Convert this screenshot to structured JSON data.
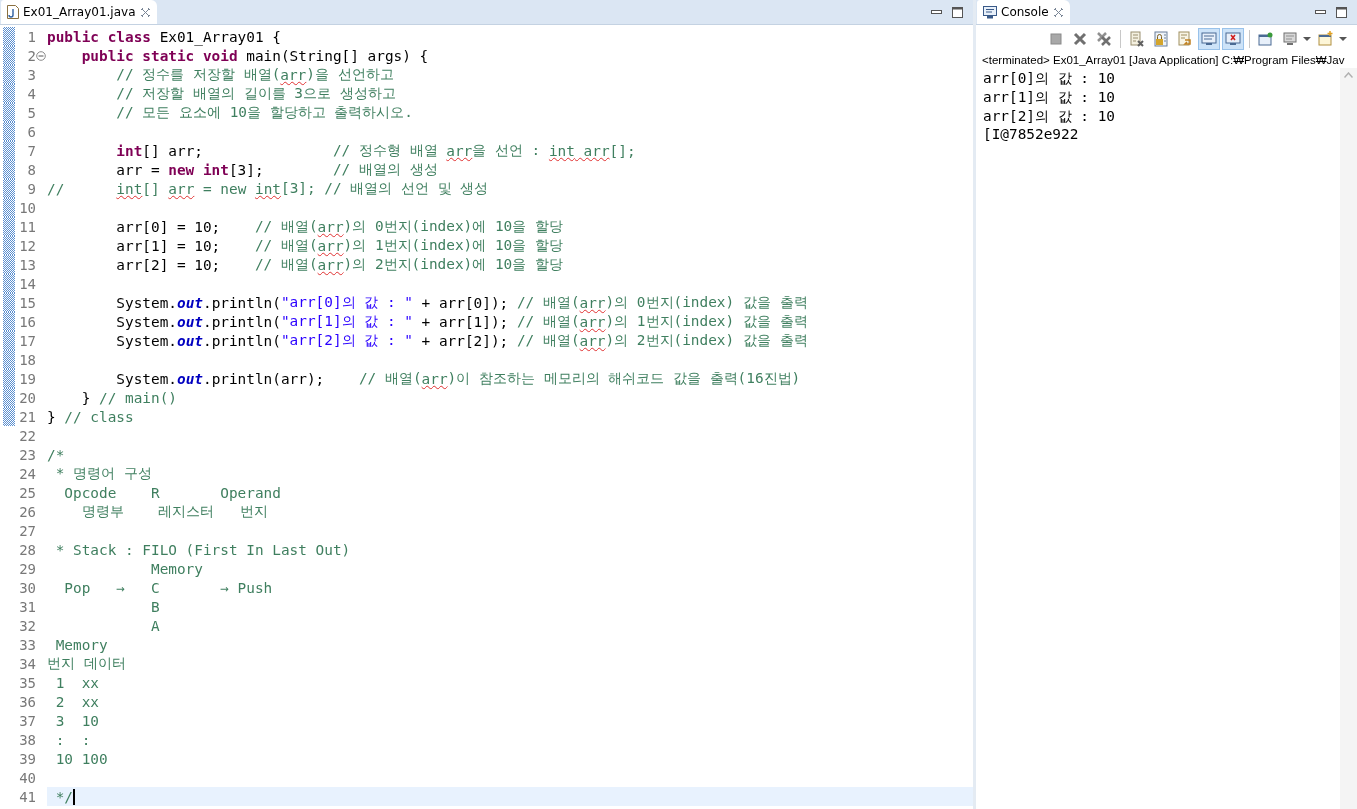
{
  "editor": {
    "tabs": [
      {
        "label": "Ex01_Array01.java",
        "selected": true
      }
    ],
    "lines": [
      {
        "number": "1",
        "changed": true,
        "fold": false,
        "current": false,
        "segments": [
          {
            "kind": "kw",
            "text": "public"
          },
          {
            "kind": "kw",
            "text": " class"
          },
          {
            "kind": "tx",
            "text": " Ex01_Array01 {"
          }
        ]
      },
      {
        "number": "2",
        "changed": true,
        "fold": true,
        "current": false,
        "segments": [
          {
            "kind": "kw",
            "text": "    public"
          },
          {
            "kind": "kw",
            "text": " static"
          },
          {
            "kind": "kw",
            "text": " void"
          },
          {
            "kind": "tx",
            "text": " main(String[] args) {"
          }
        ]
      },
      {
        "number": "3",
        "changed": true,
        "fold": false,
        "current": false,
        "segments": [
          {
            "kind": "cm",
            "text": "        // 정수를 저장할 배열("
          },
          {
            "kind": "spell",
            "text": "arr"
          },
          {
            "kind": "cm",
            "text": ")을 선언하고"
          }
        ]
      },
      {
        "number": "4",
        "changed": true,
        "fold": false,
        "current": false,
        "segments": [
          {
            "kind": "cm",
            "text": "        // 저장할 배열의 길이를 3으로 생성하고"
          }
        ]
      },
      {
        "number": "5",
        "changed": true,
        "fold": false,
        "current": false,
        "segments": [
          {
            "kind": "cm",
            "text": "        // 모든 요소에 10을 할당하고 출력하시오."
          }
        ]
      },
      {
        "number": "6",
        "changed": true,
        "fold": false,
        "current": false
      },
      {
        "number": "7",
        "changed": true,
        "fold": false,
        "current": false,
        "segments": [
          {
            "kind": "kw",
            "text": "        int"
          },
          {
            "kind": "tx",
            "text": "[] arr;"
          },
          {
            "kind": "cm",
            "text": "               // 정수형 배열 "
          },
          {
            "kind": "spell",
            "text": "arr"
          },
          {
            "kind": "cm",
            "text": "을 선언 : "
          },
          {
            "kind": "spell",
            "text": "int"
          },
          {
            "kind": "spell",
            "text": " arr"
          },
          {
            "kind": "cm",
            "text": "[];"
          }
        ]
      },
      {
        "number": "8",
        "changed": true,
        "fold": false,
        "current": false,
        "segments": [
          {
            "kind": "tx",
            "text": "        arr = "
          },
          {
            "kind": "kw",
            "text": "new"
          },
          {
            "kind": "kw",
            "text": " int"
          },
          {
            "kind": "tx",
            "text": "[3];"
          },
          {
            "kind": "cm",
            "text": "        // 배열의 생성"
          }
        ]
      },
      {
        "number": "9",
        "changed": true,
        "fold": false,
        "current": false,
        "segments": [
          {
            "kind": "cm",
            "text": "//      "
          },
          {
            "kind": "spell",
            "text": "int"
          },
          {
            "kind": "cm",
            "text": "[] "
          },
          {
            "kind": "spell",
            "text": "arr"
          },
          {
            "kind": "cm",
            "text": " = new "
          },
          {
            "kind": "spell",
            "text": "int"
          },
          {
            "kind": "cm",
            "text": "[3]; // 배열의 선언 및 생성"
          }
        ]
      },
      {
        "number": "10",
        "changed": true,
        "fold": false,
        "current": false
      },
      {
        "number": "11",
        "changed": true,
        "fold": false,
        "current": false,
        "segments": [
          {
            "kind": "tx",
            "text": "        arr[0] = 10;    "
          },
          {
            "kind": "cm",
            "text": "// 배열("
          },
          {
            "kind": "spell",
            "text": "arr"
          },
          {
            "kind": "cm",
            "text": ")의 0번지(index)에 10을 할당"
          }
        ]
      },
      {
        "number": "12",
        "changed": true,
        "fold": false,
        "current": false,
        "segments": [
          {
            "kind": "tx",
            "text": "        arr[1] = 10;    "
          },
          {
            "kind": "cm",
            "text": "// 배열("
          },
          {
            "kind": "spell",
            "text": "arr"
          },
          {
            "kind": "cm",
            "text": ")의 1번지(index)에 10을 할당"
          }
        ]
      },
      {
        "number": "13",
        "changed": true,
        "fold": false,
        "current": false,
        "segments": [
          {
            "kind": "tx",
            "text": "        arr[2] = 10;    "
          },
          {
            "kind": "cm",
            "text": "// 배열("
          },
          {
            "kind": "spell",
            "text": "arr"
          },
          {
            "kind": "cm",
            "text": ")의 2번지(index)에 10을 할당"
          }
        ]
      },
      {
        "number": "14",
        "changed": true,
        "fold": false,
        "current": false
      },
      {
        "number": "15",
        "changed": true,
        "fold": false,
        "current": false,
        "segments": [
          {
            "kind": "tx",
            "text": "        System."
          },
          {
            "kind": "field",
            "text": "out"
          },
          {
            "kind": "tx",
            "text": ".println("
          },
          {
            "kind": "str",
            "text": "\"arr[0]의 값 : \""
          },
          {
            "kind": "tx",
            "text": " + arr[0]); "
          },
          {
            "kind": "cm",
            "text": "// 배열("
          },
          {
            "kind": "spell",
            "text": "arr"
          },
          {
            "kind": "cm",
            "text": ")의 0번지(index) 값을 출력"
          }
        ]
      },
      {
        "number": "16",
        "changed": true,
        "fold": false,
        "current": false,
        "segments": [
          {
            "kind": "tx",
            "text": "        System."
          },
          {
            "kind": "field",
            "text": "out"
          },
          {
            "kind": "tx",
            "text": ".println("
          },
          {
            "kind": "str",
            "text": "\"arr[1]의 값 : \""
          },
          {
            "kind": "tx",
            "text": " + arr[1]); "
          },
          {
            "kind": "cm",
            "text": "// 배열("
          },
          {
            "kind": "spell",
            "text": "arr"
          },
          {
            "kind": "cm",
            "text": ")의 1번지(index) 값을 출력"
          }
        ]
      },
      {
        "number": "17",
        "changed": true,
        "fold": false,
        "current": false,
        "segments": [
          {
            "kind": "tx",
            "text": "        System."
          },
          {
            "kind": "field",
            "text": "out"
          },
          {
            "kind": "tx",
            "text": ".println("
          },
          {
            "kind": "str",
            "text": "\"arr[2]의 값 : \""
          },
          {
            "kind": "tx",
            "text": " + arr[2]); "
          },
          {
            "kind": "cm",
            "text": "// 배열("
          },
          {
            "kind": "spell",
            "text": "arr"
          },
          {
            "kind": "cm",
            "text": ")의 2번지(index) 값을 출력"
          }
        ]
      },
      {
        "number": "18",
        "changed": true,
        "fold": false,
        "current": false
      },
      {
        "number": "19",
        "changed": true,
        "fold": false,
        "current": false,
        "segments": [
          {
            "kind": "tx",
            "text": "        System."
          },
          {
            "kind": "field",
            "text": "out"
          },
          {
            "kind": "tx",
            "text": ".println(arr);    "
          },
          {
            "kind": "cm",
            "text": "// 배열("
          },
          {
            "kind": "spell",
            "text": "arr"
          },
          {
            "kind": "cm",
            "text": ")이 참조하는 메모리의 해쉬코드 값을 출력(16진법)"
          }
        ]
      },
      {
        "number": "20",
        "changed": true,
        "fold": false,
        "current": false,
        "segments": [
          {
            "kind": "tx",
            "text": "    } "
          },
          {
            "kind": "cm",
            "text": "// main()"
          }
        ]
      },
      {
        "number": "21",
        "changed": true,
        "fold": false,
        "current": false,
        "segments": [
          {
            "kind": "tx",
            "text": "} "
          },
          {
            "kind": "cm",
            "text": "// class"
          }
        ]
      },
      {
        "number": "22",
        "changed": false,
        "fold": false,
        "current": false
      },
      {
        "number": "23",
        "changed": false,
        "fold": false,
        "current": false,
        "segments": [
          {
            "kind": "cm",
            "text": "/*"
          }
        ]
      },
      {
        "number": "24",
        "changed": false,
        "fold": false,
        "current": false,
        "segments": [
          {
            "kind": "cm",
            "text": " * 명령어 구성"
          }
        ]
      },
      {
        "number": "25",
        "changed": false,
        "fold": false,
        "current": false,
        "segments": [
          {
            "kind": "cm",
            "text": "  Opcode    R       Operand"
          }
        ]
      },
      {
        "number": "26",
        "changed": false,
        "fold": false,
        "current": false,
        "segments": [
          {
            "kind": "cm",
            "text": "    명령부    레지스터   번지"
          }
        ]
      },
      {
        "number": "27",
        "changed": false,
        "fold": false,
        "current": false
      },
      {
        "number": "28",
        "changed": false,
        "fold": false,
        "current": false,
        "segments": [
          {
            "kind": "cm",
            "text": " * Stack : FILO (First In Last Out)"
          }
        ]
      },
      {
        "number": "29",
        "changed": false,
        "fold": false,
        "current": false,
        "segments": [
          {
            "kind": "cm",
            "text": "            Memory"
          }
        ]
      },
      {
        "number": "30",
        "changed": false,
        "fold": false,
        "current": false,
        "segments": [
          {
            "kind": "cm",
            "text": "  Pop   →   C       → Push"
          }
        ]
      },
      {
        "number": "31",
        "changed": false,
        "fold": false,
        "current": false,
        "segments": [
          {
            "kind": "cm",
            "text": "            B"
          }
        ]
      },
      {
        "number": "32",
        "changed": false,
        "fold": false,
        "current": false,
        "segments": [
          {
            "kind": "cm",
            "text": "            A"
          }
        ]
      },
      {
        "number": "33",
        "changed": false,
        "fold": false,
        "current": false,
        "segments": [
          {
            "kind": "cm",
            "text": " Memory"
          }
        ]
      },
      {
        "number": "34",
        "changed": false,
        "fold": false,
        "current": false,
        "segments": [
          {
            "kind": "cm",
            "text": "번지 데이터"
          }
        ]
      },
      {
        "number": "35",
        "changed": false,
        "fold": false,
        "current": false,
        "segments": [
          {
            "kind": "cm",
            "text": " 1  xx"
          }
        ]
      },
      {
        "number": "36",
        "changed": false,
        "fold": false,
        "current": false,
        "segments": [
          {
            "kind": "cm",
            "text": " 2  xx"
          }
        ]
      },
      {
        "number": "37",
        "changed": false,
        "fold": false,
        "current": false,
        "segments": [
          {
            "kind": "cm",
            "text": " 3  10"
          }
        ]
      },
      {
        "number": "38",
        "changed": false,
        "fold": false,
        "current": false,
        "segments": [
          {
            "kind": "cm",
            "text": " :  :"
          }
        ]
      },
      {
        "number": "39",
        "changed": false,
        "fold": false,
        "current": false,
        "segments": [
          {
            "kind": "cm",
            "text": " 10 100"
          }
        ]
      },
      {
        "number": "40",
        "changed": false,
        "fold": false,
        "current": false
      },
      {
        "number": "41",
        "changed": false,
        "fold": false,
        "current": true,
        "segments": [
          {
            "kind": "cm",
            "text": " */"
          }
        ]
      }
    ]
  },
  "console": {
    "tabs": [
      {
        "label": "Console",
        "selected": true
      }
    ],
    "toolbar": [
      {
        "kind": "stop",
        "on": false,
        "dropdown": false
      },
      {
        "kind": "remove",
        "on": false,
        "dropdown": false
      },
      {
        "kind": "remove-all",
        "on": false,
        "dropdown": false
      },
      {
        "kind": "clear",
        "on": false,
        "dropdown": false
      },
      {
        "kind": "lock",
        "on": false,
        "dropdown": false
      },
      {
        "kind": "wrap",
        "on": false,
        "dropdown": false
      },
      {
        "kind": "stdout",
        "on": true,
        "dropdown": false
      },
      {
        "kind": "stderr",
        "on": true,
        "dropdown": false
      },
      {
        "kind": "pin",
        "on": false,
        "dropdown": false
      },
      {
        "kind": "display",
        "on": false,
        "dropdown": true
      },
      {
        "kind": "open",
        "on": false,
        "dropdown": true
      }
    ],
    "status": "<terminated> Ex01_Array01 [Java Application] C:₩Program Files₩Jav",
    "output": [
      "arr[0]의 값 : 10",
      "arr[1]의 값 : 10",
      "arr[2]의 값 : 10",
      "[I@7852e922"
    ]
  }
}
